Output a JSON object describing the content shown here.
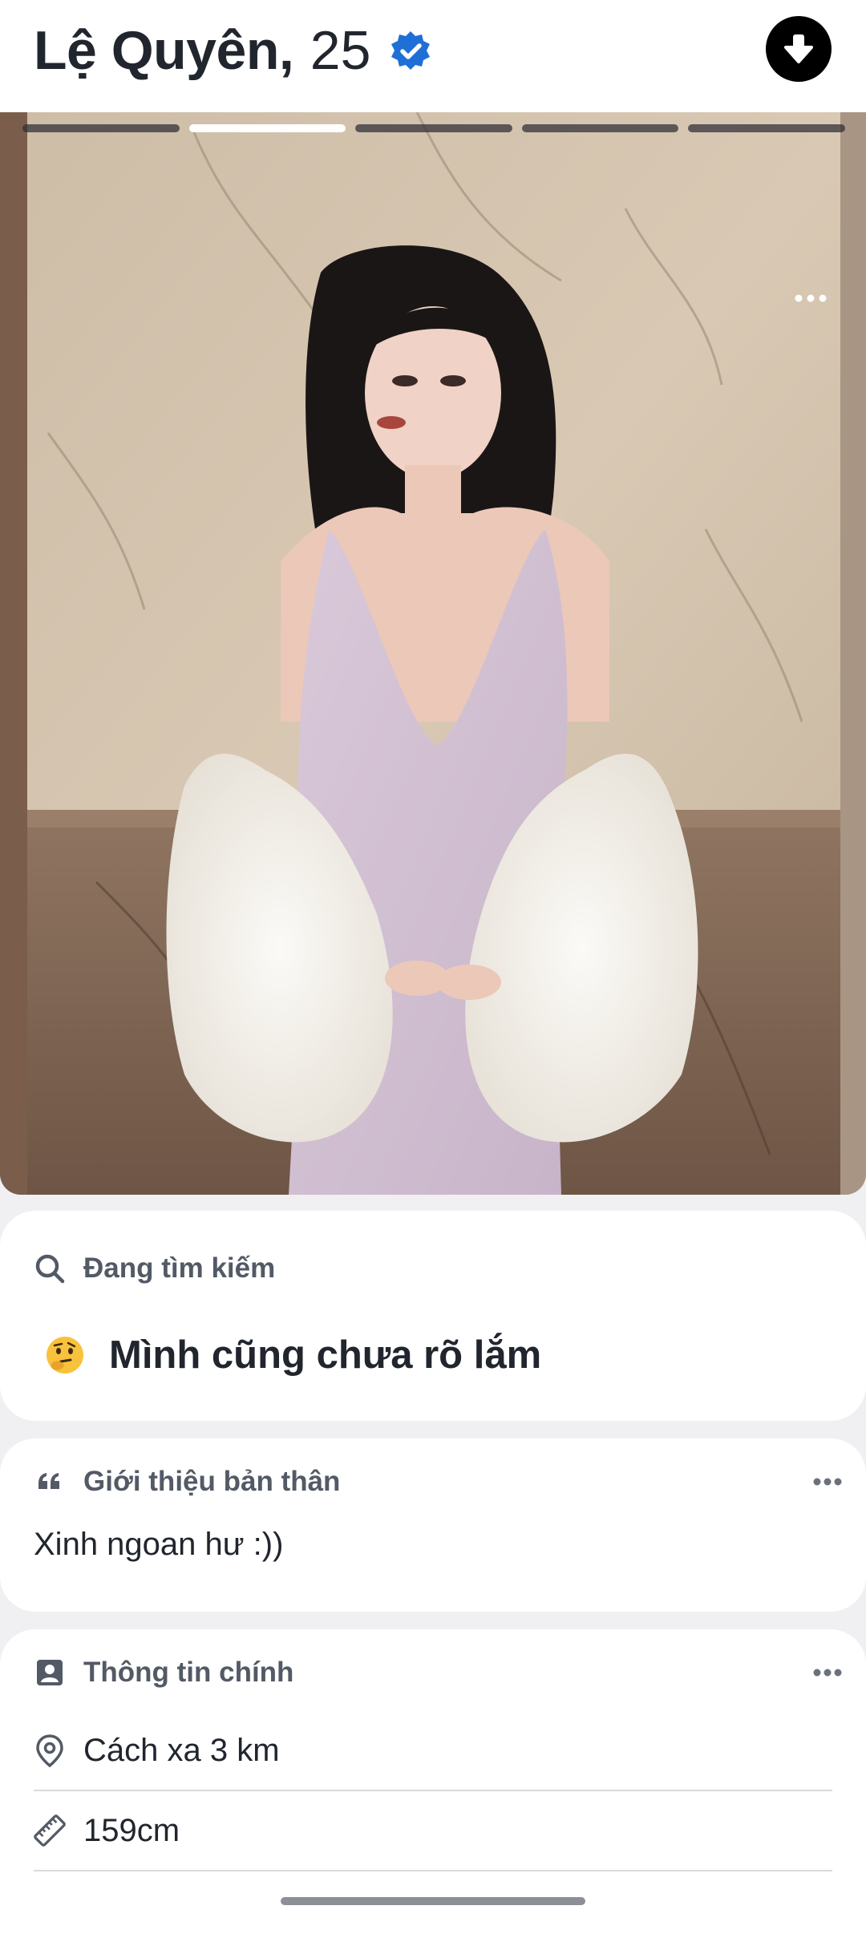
{
  "profile": {
    "name": "Lệ Quyên",
    "comma": ",",
    "age": "25",
    "verified_icon": "verified-badge-icon",
    "collapse_icon": "arrow-down-icon"
  },
  "photo": {
    "segments_total": 5,
    "active_segment": 2,
    "more_icon": "more-dots-icon"
  },
  "looking_for": {
    "title": "Đang tìm kiếm",
    "icon": "search-icon",
    "emoji_icon": "thinking-face-emoji",
    "value": "Mình cũng chưa rõ lắm"
  },
  "bio": {
    "title": "Giới thiệu bản thân",
    "icon": "quote-icon",
    "text": "Xinh ngoan hư :))"
  },
  "basics": {
    "title": "Thông tin chính",
    "icon": "id-card-icon",
    "rows": [
      {
        "icon": "location-pin-icon",
        "text": "Cách xa 3 km"
      },
      {
        "icon": "ruler-icon",
        "text": "159cm"
      }
    ]
  },
  "colors": {
    "verified_blue": "#1f6fd6",
    "text_dark": "#21262e",
    "section_gray": "#535a66",
    "page_bg": "#f0f0f3"
  }
}
